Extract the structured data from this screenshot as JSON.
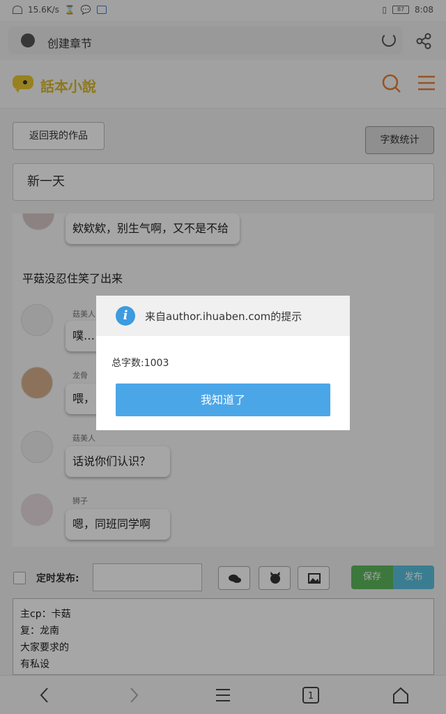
{
  "status_bar": {
    "speed": "15.6K/s",
    "battery": "87",
    "time": "8:08"
  },
  "browser": {
    "page_title": "创建章节"
  },
  "site": {
    "logo_text": "話本小說",
    "brand_color": "#d9b928",
    "accent_color": "#e67e3a"
  },
  "editor": {
    "back_button": "返回我的作品",
    "word_count_button": "字数统计",
    "chapter_title": "新一天",
    "messages": [
      {
        "name": "",
        "text": "欸欸欸，别生气啊，又不是不给"
      },
      {
        "narration": "平菇没忍住笑了出来"
      },
      {
        "name": "菇美人",
        "text": "噗…"
      },
      {
        "name": "龙骨",
        "text": "喂，"
      },
      {
        "name": "菇美人",
        "text": "话说你们认识？"
      },
      {
        "name": "狮子",
        "text": "嗯，同班同学啊"
      }
    ],
    "timed_publish_label": "定时发布:",
    "save_button": "保存",
    "publish_button": "发布",
    "notes": [
      "主cp：卡菇",
      "复：龙南",
      "大家要求的",
      "有私设"
    ]
  },
  "dialog": {
    "title": "来自author.ihuaben.com的提示",
    "message": "总字数:1003",
    "ok_button": "我知道了"
  },
  "nav": {
    "tab_count": "1"
  }
}
